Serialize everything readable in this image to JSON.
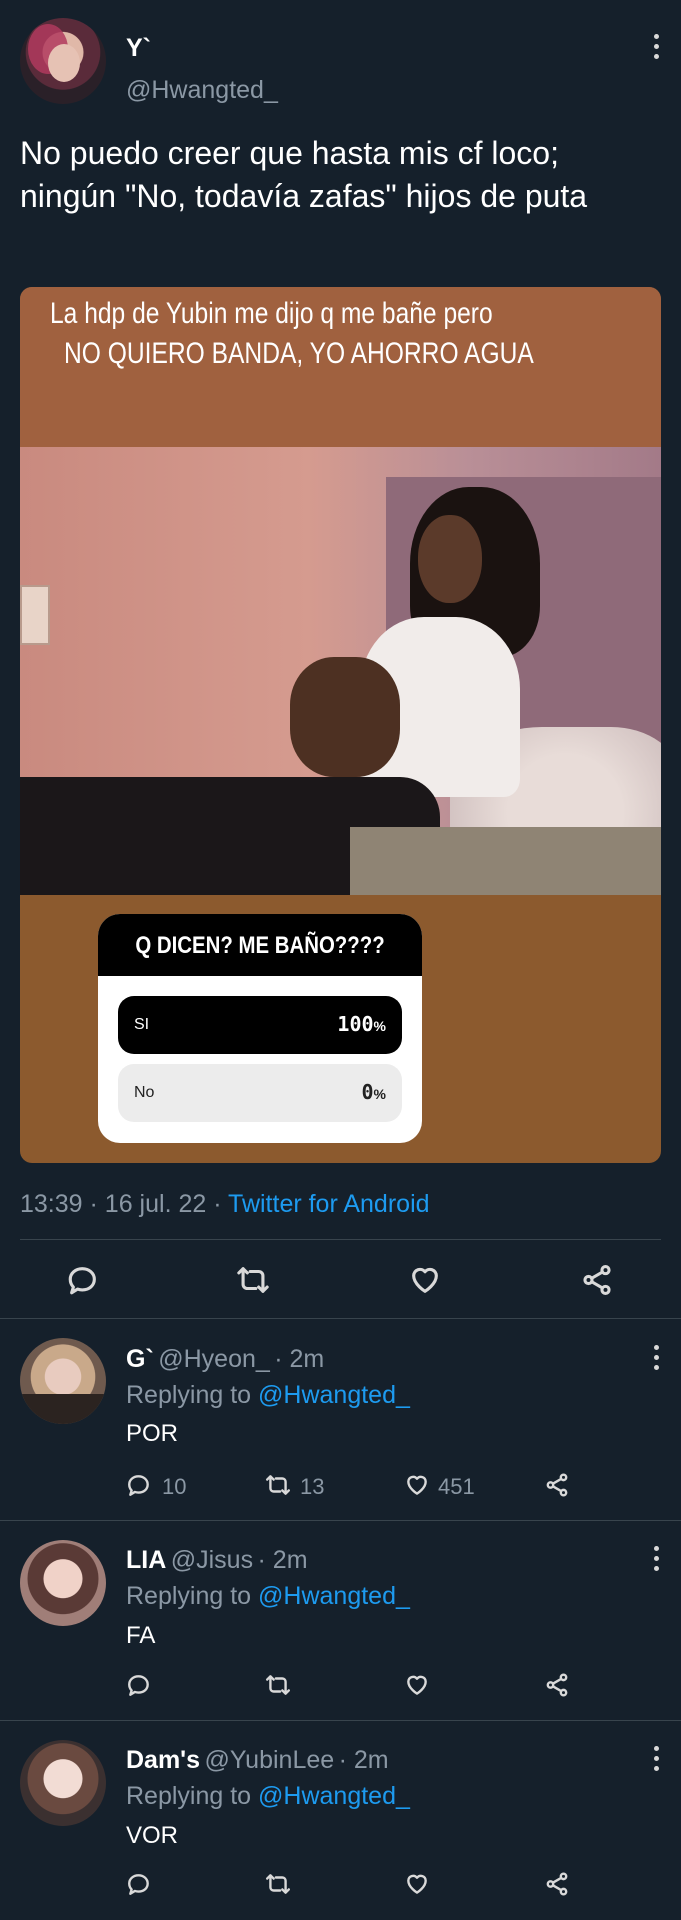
{
  "tweet": {
    "author_name": "Y`",
    "author_handle": "@Hwangted_",
    "text": "No puedo creer que hasta mis cf loco; ningún \"No, todavía zafas\" hijos de puta",
    "meme": {
      "top_line_1": "La hdp de Yubin me dijo q me bañe pero",
      "top_line_2": "NO QUIERO BANDA, YO AHORRO AGUA",
      "poll_question": "Q DICEN? ME BAÑO????",
      "poll_options": [
        {
          "label": "SI",
          "percent": "100",
          "fraction": 1.0
        },
        {
          "label": "No",
          "percent": "0",
          "fraction": 0.0
        }
      ],
      "percent_sign": "%"
    },
    "time": "13:39",
    "sep1": "·",
    "date": "16 jul. 22",
    "sep2": "·",
    "source": "Twitter for Android"
  },
  "replies": [
    {
      "name": "G`",
      "handle": "@Hyeon_",
      "time": "· 2m",
      "replying_prefix": "Replying to",
      "replying_handle": "@Hwangted_",
      "text": "POR",
      "reply_count": "10",
      "retweet_count": "13",
      "like_count": "451"
    },
    {
      "name": "LIA",
      "handle": "@Jisus",
      "time": "· 2m",
      "replying_prefix": "Replying to",
      "replying_handle": "@Hwangted_",
      "text": "FA",
      "reply_count": "",
      "retweet_count": "",
      "like_count": ""
    },
    {
      "name": "Dam's",
      "handle": "@YubinLee",
      "time": "· 2m",
      "replying_prefix": "Replying to",
      "replying_handle": "@Hwangted_",
      "text": "VOR",
      "reply_count": "",
      "retweet_count": "",
      "like_count": ""
    }
  ],
  "icons": {
    "reply": "reply-icon",
    "retweet": "retweet-icon",
    "like": "heart-icon",
    "share": "share-icon",
    "more": "more-icon"
  },
  "colors": {
    "background": "#15202b",
    "accent": "#1d9bf0",
    "meme_band": "#a0613f",
    "meme_bottom": "#8c5a2e"
  }
}
